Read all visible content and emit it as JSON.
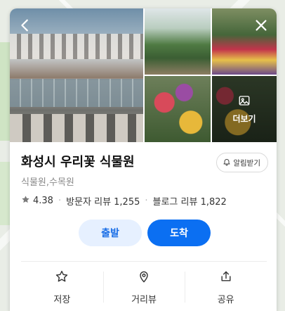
{
  "place": {
    "name": "화성시 우리꽃 식물원",
    "category": "식물원,수목원",
    "rating": "4.38",
    "visitor_reviews": "방문자 리뷰 1,255",
    "blog_reviews": "블로그 리뷰 1,822"
  },
  "photos": {
    "more_label": "더보기"
  },
  "alarm_button": {
    "label": "알림받기"
  },
  "route": {
    "start_label": "출발",
    "arrive_label": "도착"
  },
  "actions": [
    {
      "label": "저장",
      "icon": "star-outline-icon"
    },
    {
      "label": "거리뷰",
      "icon": "location-pin-icon"
    },
    {
      "label": "공유",
      "icon": "share-icon"
    }
  ],
  "colors": {
    "accent": "#0b6ff2",
    "accent_light": "#e6f0ff"
  }
}
